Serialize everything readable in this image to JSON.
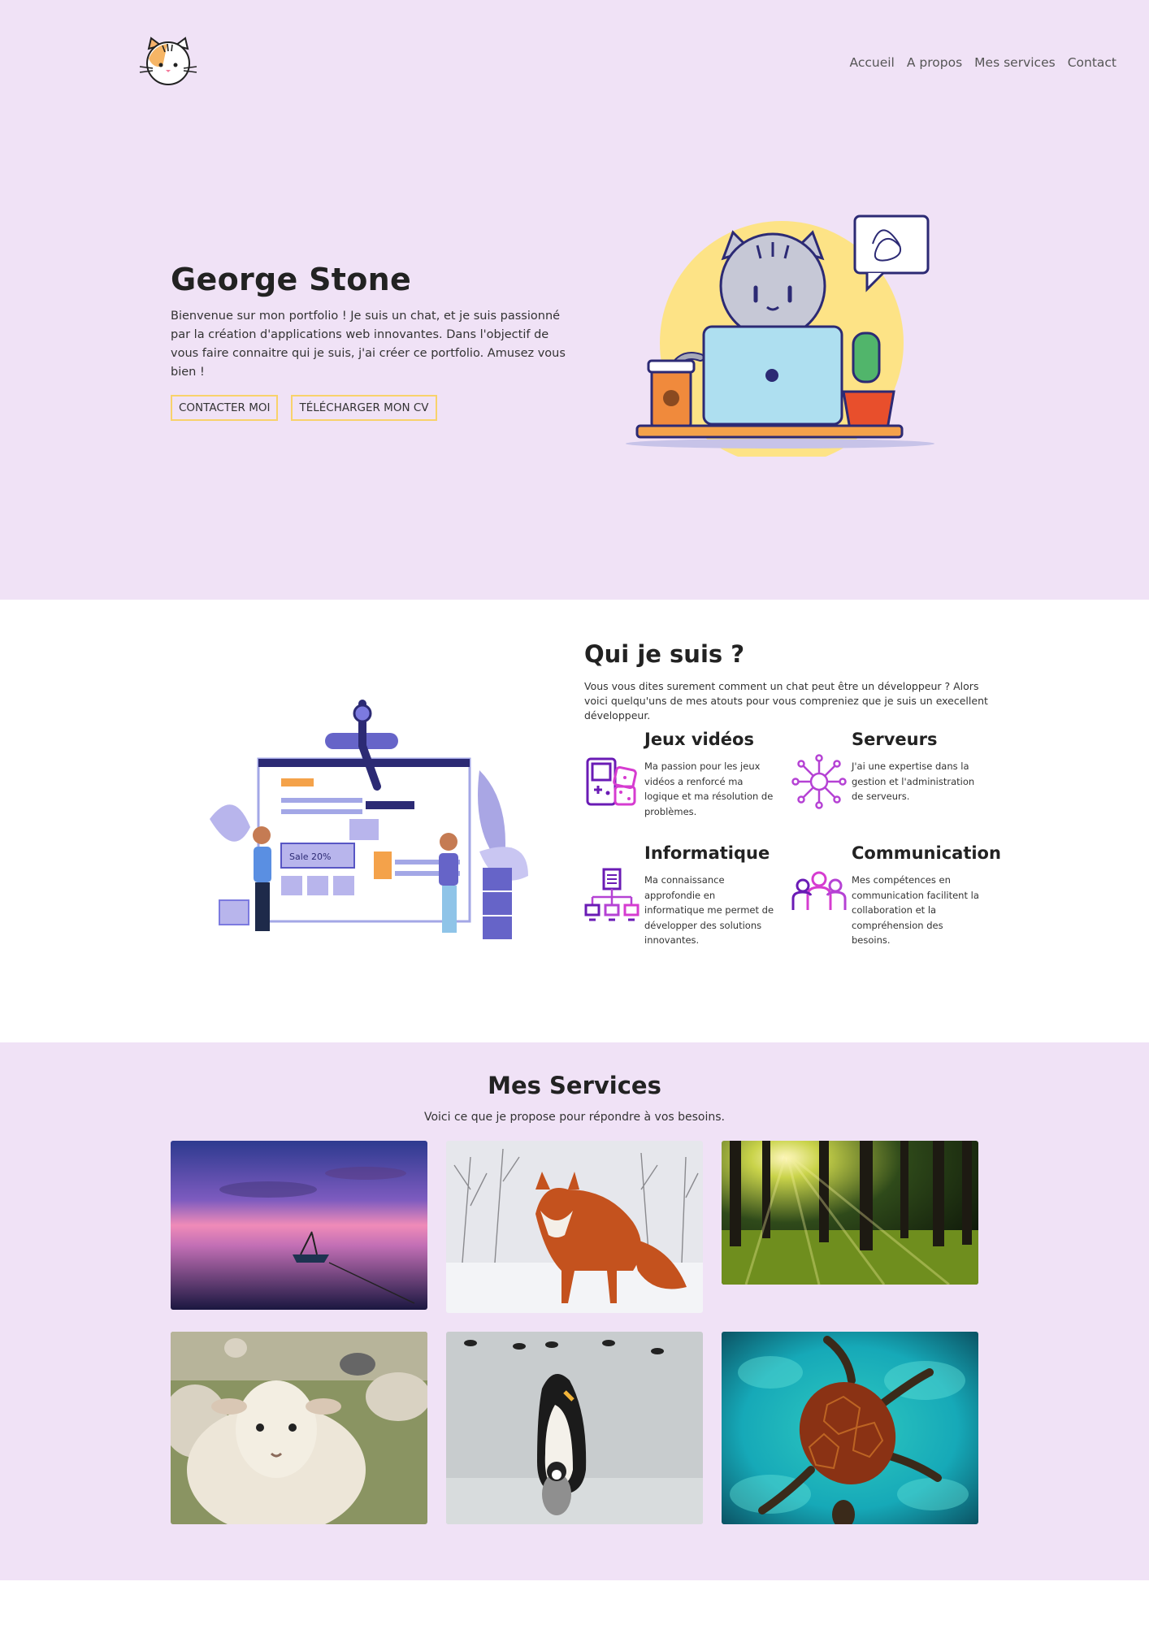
{
  "nav": {
    "items": [
      "Accueil",
      "A propos",
      "Mes services",
      "Contact"
    ]
  },
  "hero": {
    "title": "George Stone",
    "description": "Bienvenue sur mon portfolio ! Je suis un chat, et je suis passionné par la création d'applications web innovantes. Dans l'objectif de vous faire connaitre qui je suis, j'ai créer ce portfolio. Amusez vous bien !",
    "contact_button": "CONTACTER MOI",
    "cv_button": "TÉLÉCHARGER MON CV"
  },
  "about": {
    "title": "Qui je suis ?",
    "description": "Vous vous dites surement comment un chat peut être un développeur ? Alors voici quelqu'uns de mes atouts pour vous compreniez que je suis un execellent développeur.",
    "skills": [
      {
        "title": "Jeux vidéos",
        "text": "Ma passion pour les jeux vidéos a renforcé ma logique et ma résolution de problèmes.",
        "icon": "gamepad-icon"
      },
      {
        "title": "Serveurs",
        "text": "J'ai une expertise dans la gestion et l'administration de serveurs.",
        "icon": "network-icon"
      },
      {
        "title": "Informatique",
        "text": "Ma connaissance approfondie en informatique me permet de développer des solutions innovantes.",
        "icon": "hierarchy-icon"
      },
      {
        "title": "Communication",
        "text": "Mes compétences en communication facilitent la collaboration et la compréhension des besoins.",
        "icon": "people-icon"
      }
    ]
  },
  "services": {
    "title": "Mes Services",
    "subtitle": "Voici ce que je propose pour répondre à vos besoins.",
    "images": [
      "sunset-boat-image",
      "fox-image",
      "forest-image",
      "sheep-image",
      "penguin-image",
      "turtle-image"
    ]
  },
  "colors": {
    "lavender": "#f0e2f6",
    "accent_yellow": "#f8d26b",
    "icon_purple": "#6a1bb5",
    "icon_magenta": "#d63cd0"
  }
}
